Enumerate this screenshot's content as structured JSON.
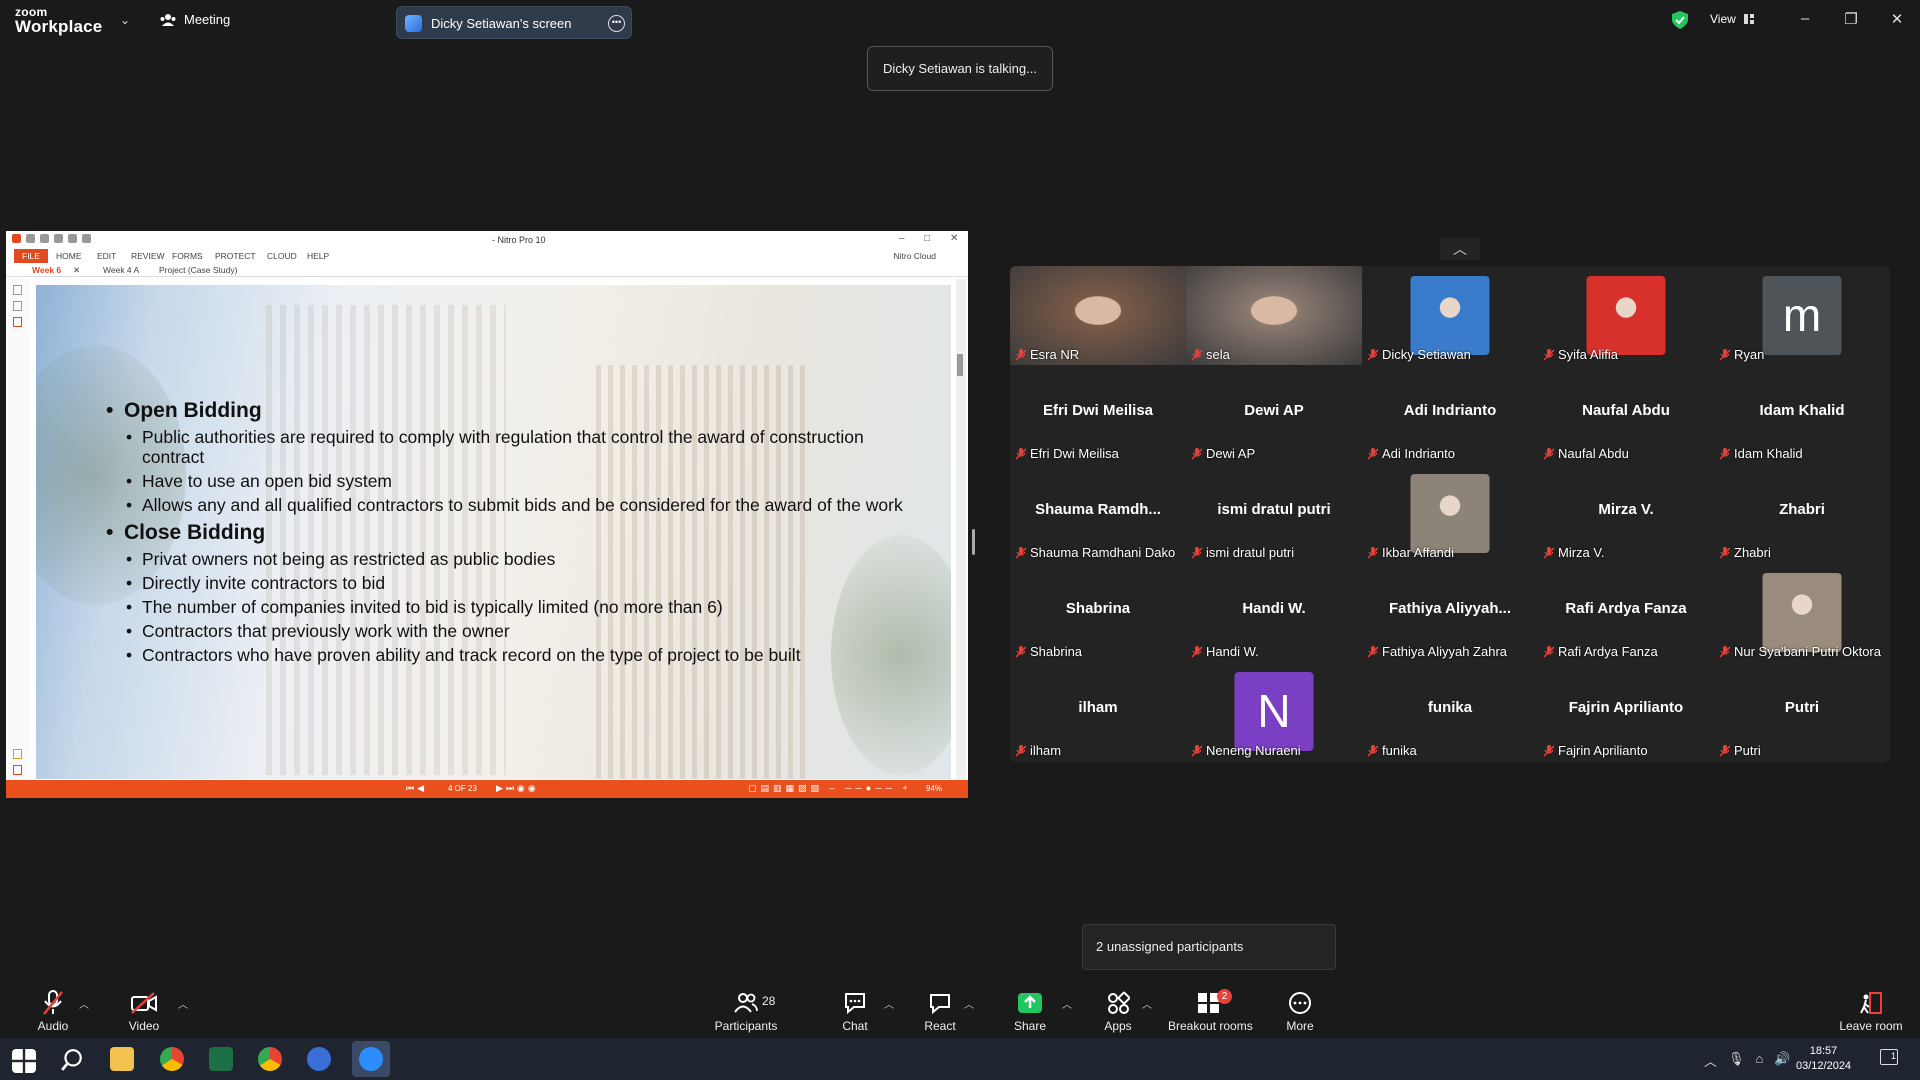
{
  "app": {
    "logo_line1": "zoom",
    "logo_line2": "Workplace",
    "meeting_label": "Meeting",
    "share_pill_label": "Dicky Setiawan's screen",
    "view_label": "View"
  },
  "toast": "Dicky Setiawan is talking...",
  "document": {
    "window_title": "- Nitro Pro 10",
    "ribbon": [
      "FILE",
      "HOME",
      "EDIT",
      "REVIEW",
      "FORMS",
      "PROTECT",
      "CLOUD",
      "HELP"
    ],
    "nitro_cloud": "Nitro Cloud",
    "tabs": [
      "Week 6",
      "Week 4 A",
      "Project (Case Study)"
    ],
    "page_indicator": "4 OF 23",
    "zoom": "94%",
    "slide": {
      "heading1": "Open Bidding",
      "bullets1": [
        "Public authorities are required to comply with regulation that control the award of construction contract",
        "Have to use an open bid system",
        "Allows any and all qualified contractors to submit bids and be considered for the award of the work"
      ],
      "heading2": "Close Bidding",
      "bullets2": [
        "Privat owners not being  as restricted as public bodies",
        "Directly invite contractors to bid",
        "The number  of companies invited to bid is typically limited (no more than 6)",
        "Contractors that previously work with the owner",
        "Contractors who have proven ability and track record on the type of project to be built"
      ]
    }
  },
  "gallery": [
    {
      "caption": "Esra NR",
      "display": "",
      "kind": "video",
      "bg": "#7a5a48"
    },
    {
      "caption": "sela",
      "display": "",
      "kind": "video",
      "bg": "#8a7a70"
    },
    {
      "caption": "Dicky Setiawan",
      "display": "",
      "kind": "image",
      "bg": "#3a7ccc"
    },
    {
      "caption": "Syifa Alifia",
      "display": "",
      "kind": "image",
      "bg": "#d8312c"
    },
    {
      "caption": "Ryan",
      "display": "m",
      "kind": "letter",
      "bg": "#4f5459"
    },
    {
      "caption": "Efri Dwi Meilisa",
      "display": "Efri Dwi Meilisa",
      "kind": "name"
    },
    {
      "caption": "Dewi AP",
      "display": "Dewi AP",
      "kind": "name"
    },
    {
      "caption": "Adi Indrianto",
      "display": "Adi Indrianto",
      "kind": "name"
    },
    {
      "caption": "Naufal Abdu",
      "display": "Naufal Abdu",
      "kind": "name"
    },
    {
      "caption": "Idam Khalid",
      "display": "Idam Khalid",
      "kind": "name"
    },
    {
      "caption": "Shauma Ramdhani Dako",
      "display": "Shauma  Ramdh...",
      "kind": "name"
    },
    {
      "caption": "ismi dratul putri",
      "display": "ismi dratul putri",
      "kind": "name"
    },
    {
      "caption": "Ikbar Affandi",
      "display": "",
      "kind": "image",
      "bg": "#8c8478"
    },
    {
      "caption": "Mirza V.",
      "display": "Mirza V.",
      "kind": "name"
    },
    {
      "caption": "Zhabri",
      "display": "Zhabri",
      "kind": "name"
    },
    {
      "caption": "Shabrina",
      "display": "Shabrina",
      "kind": "name"
    },
    {
      "caption": "Handi W.",
      "display": "Handi W.",
      "kind": "name"
    },
    {
      "caption": "Fathiya Aliyyah Zahra",
      "display": "Fathiya  Aliyyah...",
      "kind": "name"
    },
    {
      "caption": "Rafi Ardya Fanza",
      "display": "Rafi Ardya Fanza",
      "kind": "name"
    },
    {
      "caption": "Nur Sya'bani Putri Oktora",
      "display": "",
      "kind": "image",
      "bg": "#9a8c7c"
    },
    {
      "caption": "ilham",
      "display": "ilham",
      "kind": "name"
    },
    {
      "caption": "Neneng Nuraeni",
      "display": "N",
      "kind": "letter",
      "bg": "#7b3fc4"
    },
    {
      "caption": "funika",
      "display": "funika",
      "kind": "name"
    },
    {
      "caption": "Fajrin Aprilianto",
      "display": "Fajrin Aprilianto",
      "kind": "name"
    },
    {
      "caption": "Putri",
      "display": "Putri",
      "kind": "name"
    }
  ],
  "unassigned": "2 unassigned participants",
  "toolbar": {
    "audio": "Audio",
    "video": "Video",
    "participants": "Participants",
    "participants_count": "28",
    "chat": "Chat",
    "react": "React",
    "share": "Share",
    "apps": "Apps",
    "breakout": "Breakout rooms",
    "breakout_badge": "2",
    "more": "More",
    "leave": "Leave room"
  },
  "taskbar": {
    "time": "18:57",
    "date": "03/12/2024",
    "notif_count": "1"
  },
  "colors": {
    "accent_red": "#e8403a",
    "nitro_orange": "#e9501e",
    "share_green": "#22c55e",
    "mic_off_red": "#e8403a"
  }
}
